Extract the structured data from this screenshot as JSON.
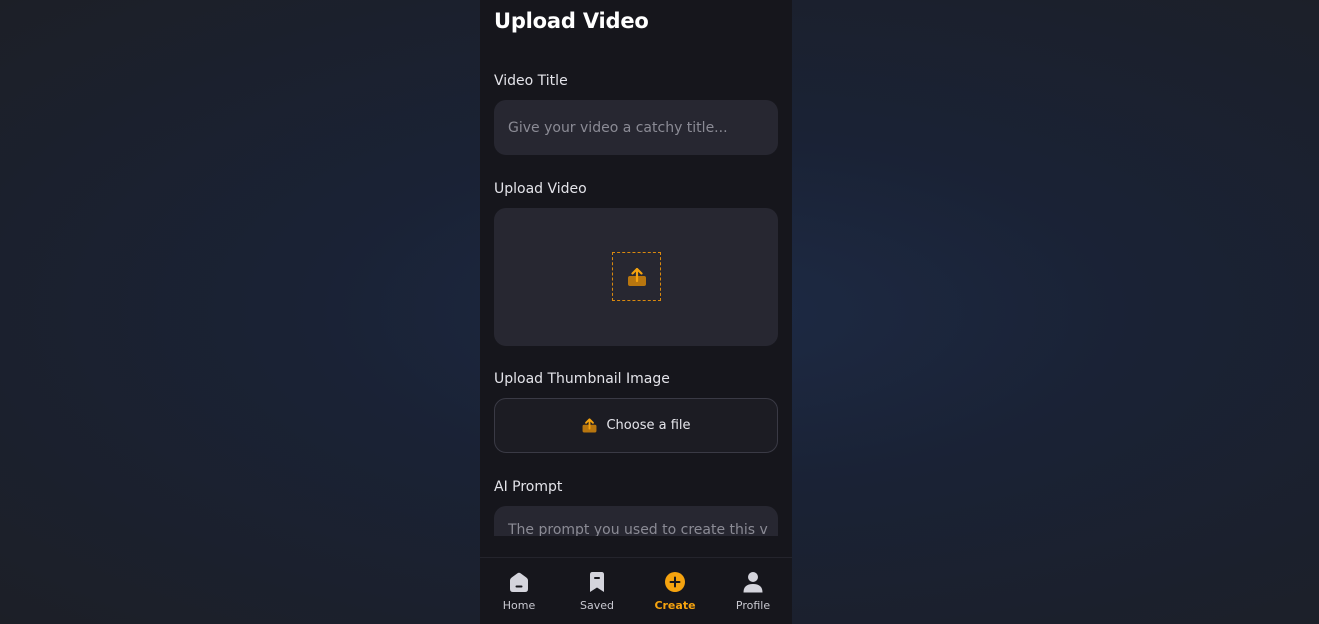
{
  "page": {
    "title": "Upload Video"
  },
  "form": {
    "video_title": {
      "label": "Video Title",
      "placeholder": "Give your video a catchy title...",
      "value": ""
    },
    "upload_video": {
      "label": "Upload Video",
      "icon": "upload-icon"
    },
    "thumbnail": {
      "label": "Upload Thumbnail Image",
      "button_label": "Choose a file",
      "icon": "upload-icon"
    },
    "ai_prompt": {
      "label": "AI Prompt",
      "placeholder": "The prompt you used to create this v"
    }
  },
  "tabbar": {
    "items": [
      {
        "label": "Home",
        "icon": "home-icon",
        "active": false
      },
      {
        "label": "Saved",
        "icon": "bookmark-icon",
        "active": false
      },
      {
        "label": "Create",
        "icon": "plus-circle-icon",
        "active": true
      },
      {
        "label": "Profile",
        "icon": "user-icon",
        "active": false
      }
    ]
  },
  "colors": {
    "accent": "#f5a30f",
    "background": "#16161c",
    "field": "#272731"
  }
}
